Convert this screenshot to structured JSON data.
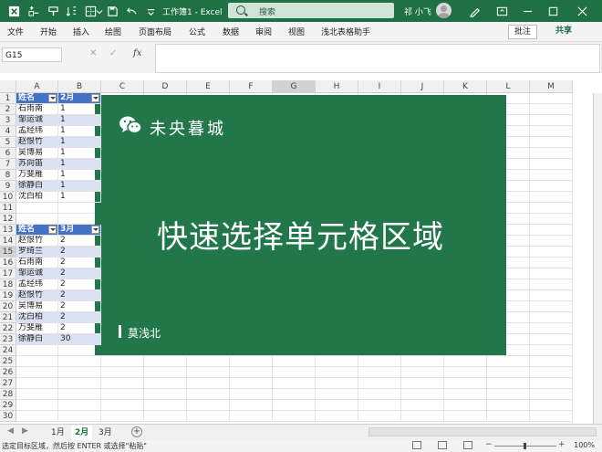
{
  "titlebar": {
    "doc_title": "工作簿1  -  Excel",
    "search_placeholder": "搜索",
    "user_name": "祁 小飞"
  },
  "ribbon": {
    "tabs": [
      "文件",
      "开始",
      "插入",
      "绘图",
      "页面布局",
      "公式",
      "数据",
      "审阅",
      "视图",
      "浅北表格助手"
    ],
    "comment_label": "批注",
    "share_label": "共享"
  },
  "formula_bar": {
    "name_box": "G15",
    "fx": "fx",
    "formula": ""
  },
  "grid": {
    "columns": [
      "A",
      "B",
      "C",
      "D",
      "E",
      "F",
      "G",
      "H",
      "I",
      "J",
      "K",
      "L",
      "M"
    ],
    "rows": [
      "1",
      "2",
      "3",
      "4",
      "5",
      "6",
      "7",
      "8",
      "9",
      "10",
      "11",
      "12",
      "13",
      "14",
      "15",
      "16",
      "17",
      "18",
      "19",
      "20",
      "21",
      "22",
      "23",
      "24",
      "25",
      "26",
      "27",
      "28",
      "29",
      "30"
    ],
    "table1": {
      "headers": [
        "姓名",
        "2月"
      ],
      "names": [
        "石雨南",
        "邹运诚",
        "孟经纬",
        "赵恨竹",
        "吴博易",
        "苏向笛",
        "万斐雁",
        "徐静白",
        "沈白柏"
      ],
      "values": [
        "1",
        "1",
        "1",
        "1",
        "1",
        "1",
        "1",
        "1",
        "1"
      ]
    },
    "table2": {
      "headers": [
        "姓名",
        "3月"
      ],
      "names": [
        "赵恨竹",
        "罗绮兰",
        "石雨南",
        "邹运诚",
        "孟经纬",
        "赵恨竹",
        "吴博易",
        "沈白柏",
        "万斐雁",
        "徐静白"
      ],
      "values": [
        "2",
        "2",
        "2",
        "2",
        "2",
        "2",
        "2",
        "2",
        "2",
        "30"
      ]
    }
  },
  "card": {
    "brand": "未央暮城",
    "title": "快速选择单元格区域",
    "author": "莫浅北"
  },
  "sheets": {
    "tabs": [
      "1月",
      "2月",
      "3月"
    ],
    "active": "2月",
    "add": "+"
  },
  "status": {
    "message": "选定目标区域，然后按 ENTER 或选择\"粘贴\"",
    "zoom": "100%"
  },
  "colors": {
    "excel_green": "#1f7145",
    "card_green": "#21764a",
    "table_header": "#4472c4",
    "table_band": "#d9e1f2"
  }
}
